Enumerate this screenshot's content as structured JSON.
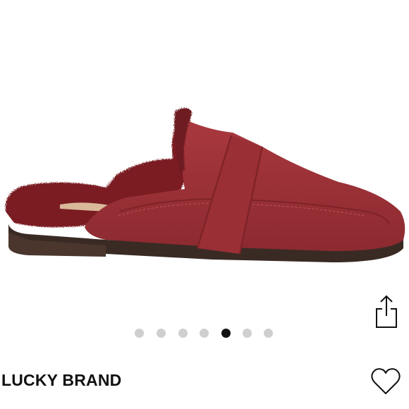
{
  "listing": {
    "brand": "LUCKY BRAND",
    "product_image_icon": "burgundy-suede-mule-with-shearling-lining",
    "carousel": {
      "total_images": 7,
      "active_index": 4
    }
  },
  "actions": {
    "share_icon": "share-icon",
    "like_icon": "heart-icon"
  },
  "colors": {
    "suede": "#9b2f35",
    "shearling": "#7a1f24",
    "sole": "#3a2a24",
    "dot_inactive": "#cfcfcf",
    "dot_active": "#111111",
    "text": "#111111"
  }
}
